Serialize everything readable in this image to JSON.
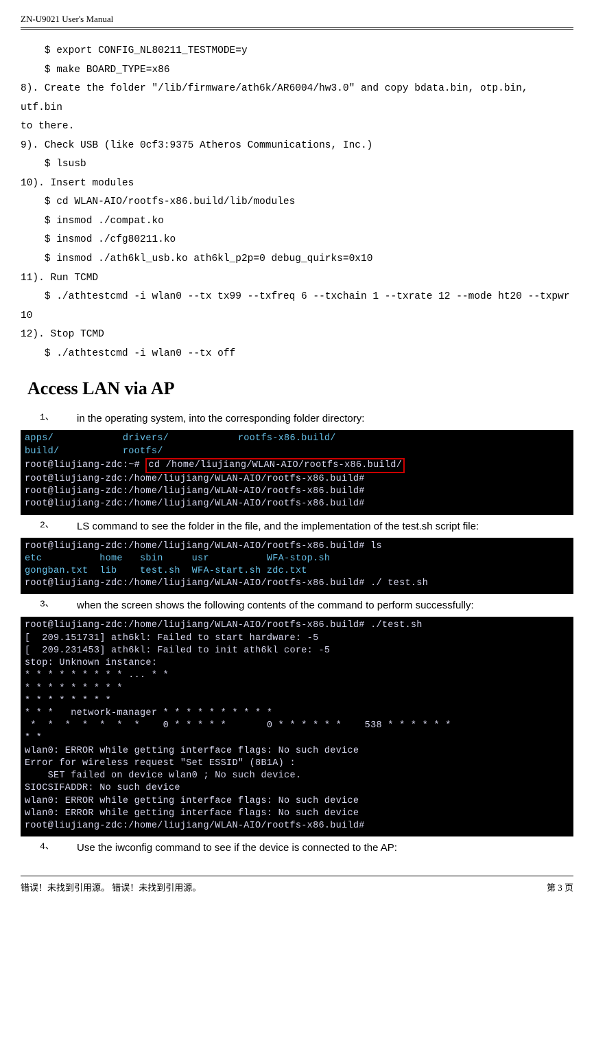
{
  "header": {
    "title": "ZN-U9021 User's Manual"
  },
  "code": {
    "l1": "    $ export CONFIG_NL80211_TESTMODE=y",
    "l2": "    $ make BOARD_TYPE=x86",
    "l3": "8). Create the folder \"/lib/firmware/ath6k/AR6004/hw3.0\" and copy bdata.bin, otp.bin, utf.bin",
    "l4": "to there.",
    "l5": "9). Check USB (like 0cf3:9375 Atheros Communications, Inc.)",
    "l6": "    $ lsusb",
    "l7": "10). Insert modules",
    "l8": "    $ cd WLAN-AIO/rootfs-x86.build/lib/modules",
    "l9": "    $ insmod ./compat.ko",
    "l10": "    $ insmod ./cfg80211.ko",
    "l11": "    $ insmod ./ath6kl_usb.ko ath6kl_p2p=0 debug_quirks=0x10",
    "l12": "11). Run TCMD",
    "l13": "    $ ./athtestcmd -i wlan0 --tx tx99 --txfreq 6 --txchain 1 --txrate 12 --mode ht20 --txpwr",
    "l14": "10",
    "l15": "12). Stop TCMD",
    "l16": "    $ ./athtestcmd -i wlan0 --tx off"
  },
  "heading_access": "Access LAN via AP",
  "items": {
    "n1": "1、",
    "t1": "in the operating system, into the corresponding folder directory:",
    "n2": "2、",
    "t2": "LS command to see the folder in the file, and the implementation of the test.sh script file:",
    "n3": "3、",
    "t3": "when the screen shows the following contents of the command to perform successfully:",
    "n4": "4、",
    "t4": "Use the iwconfig command to see if the device is connected to the AP:"
  },
  "shot1": {
    "l1": "apps/            drivers/            rootfs-x86.build/",
    "l2": "build/           rootfs/",
    "l3a": "root@liujiang-zdc:~# ",
    "l3b": "cd /home/liujiang/WLAN-AIO/rootfs-x86.build/",
    "l4": "root@liujiang-zdc:/home/liujiang/WLAN-AIO/rootfs-x86.build#",
    "l5": "root@liujiang-zdc:/home/liujiang/WLAN-AIO/rootfs-x86.build#",
    "l6": "root@liujiang-zdc:/home/liujiang/WLAN-AIO/rootfs-x86.build#"
  },
  "shot2": {
    "l1": "root@liujiang-zdc:/home/liujiang/WLAN-AIO/rootfs-x86.build# ls",
    "l2": "etc          home   sbin     usr          WFA-stop.sh",
    "l3": "gongban.txt  lib    test.sh  WFA-start.sh zdc.txt",
    "l4": "root@liujiang-zdc:/home/liujiang/WLAN-AIO/rootfs-x86.build# ./ test.sh"
  },
  "shot3": {
    "l1": "root@liujiang-zdc:/home/liujiang/WLAN-AIO/rootfs-x86.build# ./test.sh",
    "l2": "[  209.151731] ath6kl: Failed to start hardware: -5",
    "l3": "[  209.231453] ath6kl: Failed to init ath6kl core: -5",
    "l4": "stop: Unknown instance:",
    "l5": "* * * * * * * * * ... * *",
    "l6": "* * * * * * * * *",
    "l7": "* * * * * * * *",
    "l8": "* * *   network-manager * * * * * * * * * *",
    "l9": " *  *  *  *  *  *  *    0 * * * * *       0 * * * * * *    538 * * * * * *",
    "l10": "* *",
    "l11": "wlan0: ERROR while getting interface flags: No such device",
    "l12": "Error for wireless request \"Set ESSID\" (8B1A) :",
    "l13": "    SET failed on device wlan0 ; No such device.",
    "l14": "SIOCSIFADDR: No such device",
    "l15": "wlan0: ERROR while getting interface flags: No such device",
    "l16": "wlan0: ERROR while getting interface flags: No such device",
    "l17": "root@liujiang-zdc:/home/liujiang/WLAN-AIO/rootfs-x86.build#"
  },
  "footer": {
    "left": "错误！未找到引用源。  错误！未找到引用源。",
    "right": "第 3 页"
  }
}
